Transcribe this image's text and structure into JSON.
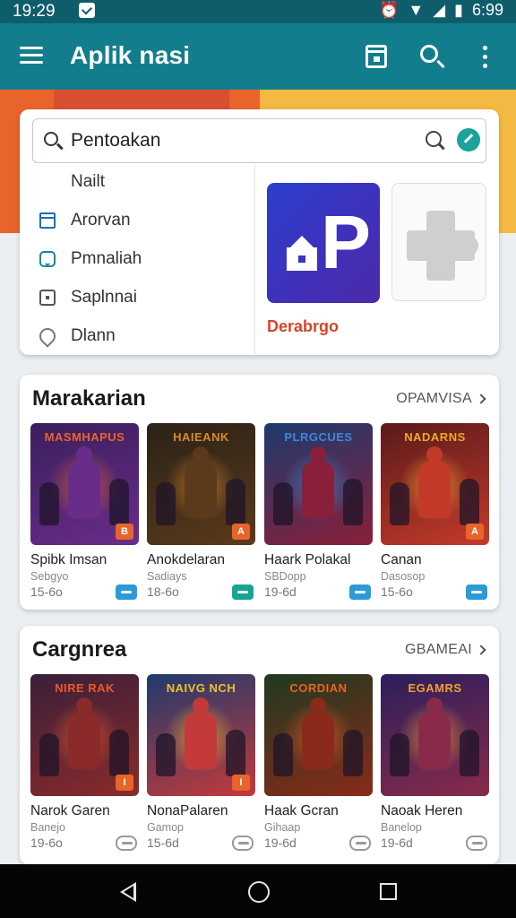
{
  "status": {
    "time_left": "19:29",
    "time_right": "6:99"
  },
  "appbar": {
    "title": "Aplik nasi"
  },
  "search": {
    "query": "Pentoakan"
  },
  "menu": {
    "header": "Nailt",
    "items": [
      {
        "label": "Arorvan",
        "icon": "calendar-icon"
      },
      {
        "label": "Pmnaliah",
        "icon": "chat-icon"
      },
      {
        "label": "Saplnnai",
        "icon": "box-icon"
      },
      {
        "label": "Dlann",
        "icon": "location-pin-icon"
      }
    ]
  },
  "featured": {
    "label": "Derabrgo"
  },
  "sections": [
    {
      "title": "Marakarian",
      "link": "OPAMVISA",
      "games": [
        {
          "art_title": "MASMHAPUS",
          "name": "Spibk Imsan",
          "sub": "Sebgyo",
          "meta": "15-6o",
          "badge": "B",
          "colors": [
            "#3a1f5c",
            "#e8642a",
            "#6a2c8a"
          ]
        },
        {
          "art_title": "HAIEANK",
          "name": "Anokdelaran",
          "sub": "Sadiays",
          "meta": "18-6o",
          "badge": "A",
          "colors": [
            "#2b2218",
            "#d98a2a",
            "#5a3a1a"
          ]
        },
        {
          "art_title": "PLRGCUES",
          "name": "Haark Polakal",
          "sub": "SBDopp",
          "meta": "19-6d",
          "badge": "",
          "colors": [
            "#1d3a6e",
            "#3a8ad8",
            "#8a1f3a"
          ]
        },
        {
          "art_title": "NADARNS",
          "name": "Canan",
          "sub": "Dasosop",
          "meta": "15-6o",
          "badge": "A",
          "colors": [
            "#5a1a1a",
            "#f0a830",
            "#c43a2a"
          ]
        }
      ]
    },
    {
      "title": "Cargnrea",
      "link": "GBAMEAI",
      "games": [
        {
          "art_title": "NIRE RAK",
          "name": "Narok Garen",
          "sub": "Banejo",
          "meta": "19-6o",
          "badge": "I",
          "colors": [
            "#3a1f3a",
            "#e85a2a",
            "#8a2a2a"
          ]
        },
        {
          "art_title": "NAIVG NCH",
          "name": "NonaPalaren",
          "sub": "Gamop",
          "meta": "15-6d",
          "badge": "I",
          "colors": [
            "#1f3a6e",
            "#f0c030",
            "#c43a3a"
          ]
        },
        {
          "art_title": "CORDIAN",
          "name": "Haak Gcran",
          "sub": "Gihaap",
          "meta": "19-6d",
          "badge": "",
          "colors": [
            "#1f3a1f",
            "#e8642a",
            "#8a2a1a"
          ]
        },
        {
          "art_title": "EGAMRS",
          "name": "Naoak Heren",
          "sub": "Banelop",
          "meta": "19-6d",
          "badge": "",
          "colors": [
            "#2a1f5c",
            "#f0a030",
            "#8a2a4a"
          ]
        }
      ]
    }
  ]
}
